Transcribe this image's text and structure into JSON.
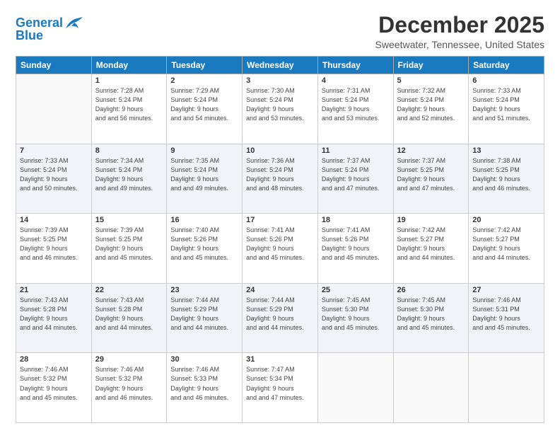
{
  "logo": {
    "line1": "General",
    "line2": "Blue"
  },
  "title": "December 2025",
  "location": "Sweetwater, Tennessee, United States",
  "days_header": [
    "Sunday",
    "Monday",
    "Tuesday",
    "Wednesday",
    "Thursday",
    "Friday",
    "Saturday"
  ],
  "weeks": [
    [
      {
        "num": "",
        "sunrise": "",
        "sunset": "",
        "daylight": ""
      },
      {
        "num": "1",
        "sunrise": "Sunrise: 7:28 AM",
        "sunset": "Sunset: 5:24 PM",
        "daylight": "Daylight: 9 hours and 56 minutes."
      },
      {
        "num": "2",
        "sunrise": "Sunrise: 7:29 AM",
        "sunset": "Sunset: 5:24 PM",
        "daylight": "Daylight: 9 hours and 54 minutes."
      },
      {
        "num": "3",
        "sunrise": "Sunrise: 7:30 AM",
        "sunset": "Sunset: 5:24 PM",
        "daylight": "Daylight: 9 hours and 53 minutes."
      },
      {
        "num": "4",
        "sunrise": "Sunrise: 7:31 AM",
        "sunset": "Sunset: 5:24 PM",
        "daylight": "Daylight: 9 hours and 53 minutes."
      },
      {
        "num": "5",
        "sunrise": "Sunrise: 7:32 AM",
        "sunset": "Sunset: 5:24 PM",
        "daylight": "Daylight: 9 hours and 52 minutes."
      },
      {
        "num": "6",
        "sunrise": "Sunrise: 7:33 AM",
        "sunset": "Sunset: 5:24 PM",
        "daylight": "Daylight: 9 hours and 51 minutes."
      }
    ],
    [
      {
        "num": "7",
        "sunrise": "Sunrise: 7:33 AM",
        "sunset": "Sunset: 5:24 PM",
        "daylight": "Daylight: 9 hours and 50 minutes."
      },
      {
        "num": "8",
        "sunrise": "Sunrise: 7:34 AM",
        "sunset": "Sunset: 5:24 PM",
        "daylight": "Daylight: 9 hours and 49 minutes."
      },
      {
        "num": "9",
        "sunrise": "Sunrise: 7:35 AM",
        "sunset": "Sunset: 5:24 PM",
        "daylight": "Daylight: 9 hours and 49 minutes."
      },
      {
        "num": "10",
        "sunrise": "Sunrise: 7:36 AM",
        "sunset": "Sunset: 5:24 PM",
        "daylight": "Daylight: 9 hours and 48 minutes."
      },
      {
        "num": "11",
        "sunrise": "Sunrise: 7:37 AM",
        "sunset": "Sunset: 5:24 PM",
        "daylight": "Daylight: 9 hours and 47 minutes."
      },
      {
        "num": "12",
        "sunrise": "Sunrise: 7:37 AM",
        "sunset": "Sunset: 5:25 PM",
        "daylight": "Daylight: 9 hours and 47 minutes."
      },
      {
        "num": "13",
        "sunrise": "Sunrise: 7:38 AM",
        "sunset": "Sunset: 5:25 PM",
        "daylight": "Daylight: 9 hours and 46 minutes."
      }
    ],
    [
      {
        "num": "14",
        "sunrise": "Sunrise: 7:39 AM",
        "sunset": "Sunset: 5:25 PM",
        "daylight": "Daylight: 9 hours and 46 minutes."
      },
      {
        "num": "15",
        "sunrise": "Sunrise: 7:39 AM",
        "sunset": "Sunset: 5:25 PM",
        "daylight": "Daylight: 9 hours and 45 minutes."
      },
      {
        "num": "16",
        "sunrise": "Sunrise: 7:40 AM",
        "sunset": "Sunset: 5:26 PM",
        "daylight": "Daylight: 9 hours and 45 minutes."
      },
      {
        "num": "17",
        "sunrise": "Sunrise: 7:41 AM",
        "sunset": "Sunset: 5:26 PM",
        "daylight": "Daylight: 9 hours and 45 minutes."
      },
      {
        "num": "18",
        "sunrise": "Sunrise: 7:41 AM",
        "sunset": "Sunset: 5:26 PM",
        "daylight": "Daylight: 9 hours and 45 minutes."
      },
      {
        "num": "19",
        "sunrise": "Sunrise: 7:42 AM",
        "sunset": "Sunset: 5:27 PM",
        "daylight": "Daylight: 9 hours and 44 minutes."
      },
      {
        "num": "20",
        "sunrise": "Sunrise: 7:42 AM",
        "sunset": "Sunset: 5:27 PM",
        "daylight": "Daylight: 9 hours and 44 minutes."
      }
    ],
    [
      {
        "num": "21",
        "sunrise": "Sunrise: 7:43 AM",
        "sunset": "Sunset: 5:28 PM",
        "daylight": "Daylight: 9 hours and 44 minutes."
      },
      {
        "num": "22",
        "sunrise": "Sunrise: 7:43 AM",
        "sunset": "Sunset: 5:28 PM",
        "daylight": "Daylight: 9 hours and 44 minutes."
      },
      {
        "num": "23",
        "sunrise": "Sunrise: 7:44 AM",
        "sunset": "Sunset: 5:29 PM",
        "daylight": "Daylight: 9 hours and 44 minutes."
      },
      {
        "num": "24",
        "sunrise": "Sunrise: 7:44 AM",
        "sunset": "Sunset: 5:29 PM",
        "daylight": "Daylight: 9 hours and 44 minutes."
      },
      {
        "num": "25",
        "sunrise": "Sunrise: 7:45 AM",
        "sunset": "Sunset: 5:30 PM",
        "daylight": "Daylight: 9 hours and 45 minutes."
      },
      {
        "num": "26",
        "sunrise": "Sunrise: 7:45 AM",
        "sunset": "Sunset: 5:30 PM",
        "daylight": "Daylight: 9 hours and 45 minutes."
      },
      {
        "num": "27",
        "sunrise": "Sunrise: 7:46 AM",
        "sunset": "Sunset: 5:31 PM",
        "daylight": "Daylight: 9 hours and 45 minutes."
      }
    ],
    [
      {
        "num": "28",
        "sunrise": "Sunrise: 7:46 AM",
        "sunset": "Sunset: 5:32 PM",
        "daylight": "Daylight: 9 hours and 45 minutes."
      },
      {
        "num": "29",
        "sunrise": "Sunrise: 7:46 AM",
        "sunset": "Sunset: 5:32 PM",
        "daylight": "Daylight: 9 hours and 46 minutes."
      },
      {
        "num": "30",
        "sunrise": "Sunrise: 7:46 AM",
        "sunset": "Sunset: 5:33 PM",
        "daylight": "Daylight: 9 hours and 46 minutes."
      },
      {
        "num": "31",
        "sunrise": "Sunrise: 7:47 AM",
        "sunset": "Sunset: 5:34 PM",
        "daylight": "Daylight: 9 hours and 47 minutes."
      },
      {
        "num": "",
        "sunrise": "",
        "sunset": "",
        "daylight": ""
      },
      {
        "num": "",
        "sunrise": "",
        "sunset": "",
        "daylight": ""
      },
      {
        "num": "",
        "sunrise": "",
        "sunset": "",
        "daylight": ""
      }
    ]
  ]
}
